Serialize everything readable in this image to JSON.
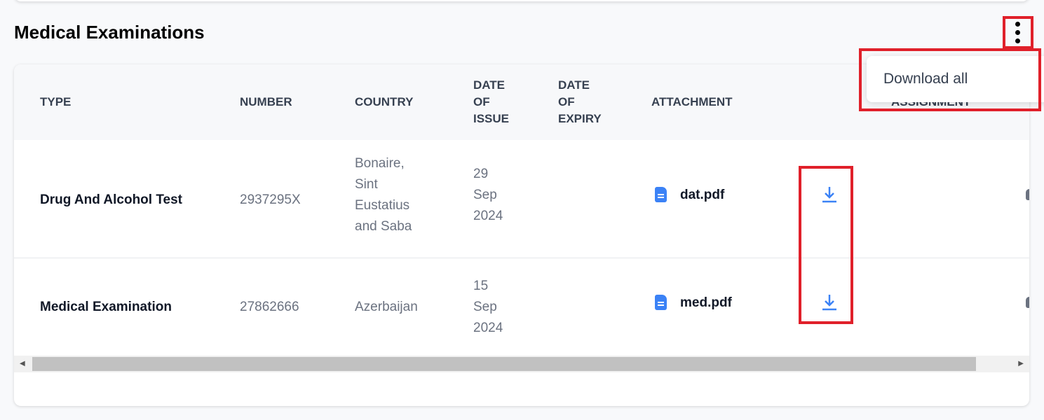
{
  "section": {
    "title": "Medical Examinations"
  },
  "menu": {
    "items": [
      "Download all"
    ]
  },
  "table": {
    "headers": {
      "type": "TYPE",
      "number": "NUMBER",
      "country": "COUNTRY",
      "date_of_issue": [
        "DATE",
        "OF",
        "ISSUE"
      ],
      "date_of_expiry": [
        "DATE",
        "OF",
        "EXPIRY"
      ],
      "attachment": "ATTACHMENT",
      "assignment": "ASSIGNMENT"
    },
    "rows": [
      {
        "type": "Drug And Alcohol Test",
        "number": "2937295X",
        "country": [
          "Bonaire,",
          "Sint",
          "Eustatius",
          "and Saba"
        ],
        "date_of_issue": [
          "29",
          "Sep",
          "2024"
        ],
        "attachment": "dat.pdf"
      },
      {
        "type": "Medical Examination",
        "number": "27862666",
        "country": [
          "Azerbaijan"
        ],
        "date_of_issue": [
          "15",
          "Sep",
          "2024"
        ],
        "attachment": "med.pdf"
      }
    ]
  },
  "colors": {
    "accent": "#3b82f6",
    "highlight": "#e0202a"
  }
}
